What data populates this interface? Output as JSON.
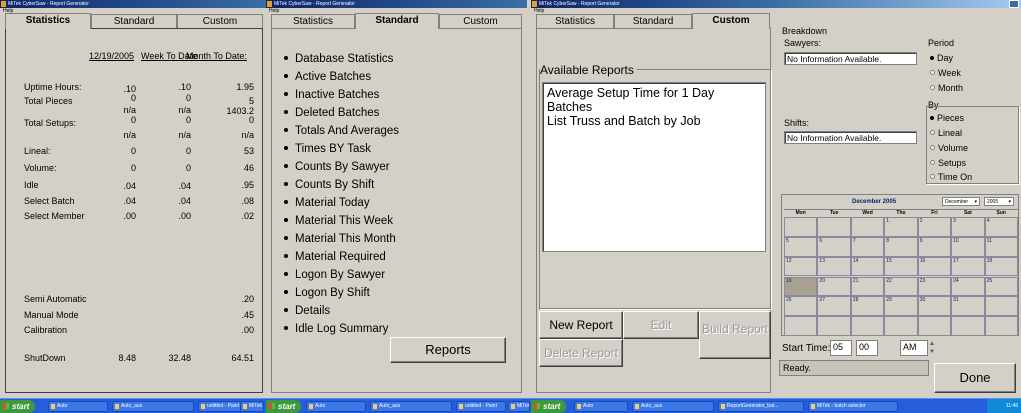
{
  "window1": {
    "title": "MiTek CyberSaw - Report Generator",
    "menu": "Help",
    "tabs": [
      "Statistics",
      "Standard",
      "Custom"
    ],
    "date": "12/19/2005",
    "col_week": "Week To Date",
    "col_month": "Month To Date:",
    "rows": [
      {
        "label": "Uptime Hours:",
        "a": ".10",
        "b": ".10",
        "c": "1.95"
      },
      {
        "label": "Total Pieces",
        "a": "0",
        "b": "0",
        "c": "5"
      },
      {
        "label": "",
        "a": "n/a",
        "b": "n/a",
        "c": "1403.2"
      },
      {
        "label": "Total Setups:",
        "a": "0",
        "b": "0",
        "c": "0"
      },
      {
        "label": "",
        "a": "n/a",
        "b": "n/a",
        "c": "n/a"
      },
      {
        "label": "Lineal:",
        "a": "0",
        "b": "0",
        "c": "53"
      },
      {
        "label": "Volume:",
        "a": "0",
        "b": "0",
        "c": "46"
      },
      {
        "label": "Idle",
        "a": ".04",
        "b": ".04",
        "c": ".95"
      },
      {
        "label": "Select Batch",
        "a": ".04",
        "b": ".04",
        "c": ".08"
      },
      {
        "label": "Select Member",
        "a": ".00",
        "b": ".00",
        "c": ".02"
      }
    ],
    "lower_rows": [
      {
        "label": "Semi Automatic",
        "c": ".20"
      },
      {
        "label": "Manual Mode",
        "c": ".45"
      },
      {
        "label": "Calibration",
        "c": ".00"
      }
    ],
    "shutdown": {
      "label": "ShutDown",
      "a": "8.48",
      "b": "32.48",
      "c": "64.51"
    }
  },
  "window2": {
    "title": "MiTek CyberSaw - Report Generator",
    "menu": "Help",
    "tabs": [
      "Statistics",
      "Standard",
      "Custom"
    ],
    "options": [
      "Database Statistics",
      "Active Batches",
      "Inactive Batches",
      "Deleted Batches",
      "Totals And Averages",
      "Times BY Task",
      "Counts By Sawyer",
      "Counts By Shift",
      "Material Today",
      "Material This Week",
      "Material This Month",
      "Material Required",
      "Logon By Sawyer",
      "Logon By Shift",
      "Details",
      "Idle Log Summary"
    ],
    "reports_button": "Reports"
  },
  "window3": {
    "title": "MiTek CyberSaw - Report Generator",
    "menu": "Help",
    "tabs": [
      "Statistics",
      "Standard",
      "Custom"
    ],
    "group_label": "Available Reports",
    "reports": [
      "Average Setup Time for 1 Day",
      "Batches",
      "List Truss and Batch by Job"
    ],
    "new_report": "New Report",
    "edit": "Edit",
    "build_report": "Build Report",
    "delete_report": "Delete Report"
  },
  "panel": {
    "breakdown": "Breakdown",
    "sawyers_label": "Sawyers:",
    "sawyers_value": "No Information Available.",
    "shifts_label": "Shifts:",
    "shifts_value": "No Information Available.",
    "period_label": "Period",
    "period_options": [
      {
        "label": "Day",
        "selected": true
      },
      {
        "label": "Week",
        "selected": false
      },
      {
        "label": "Month",
        "selected": false
      }
    ],
    "by_label": "By",
    "by_options": [
      {
        "label": "Pieces",
        "selected": true
      },
      {
        "label": "Lineal",
        "selected": false
      },
      {
        "label": "Volume",
        "selected": false
      },
      {
        "label": "Setups",
        "selected": false
      },
      {
        "label": "Time On",
        "selected": false
      }
    ],
    "calendar": {
      "title": "December 2005",
      "month_select": "December",
      "year_select": "2005",
      "days": [
        "Mon",
        "Tue",
        "Wed",
        "Thu",
        "Fri",
        "Sat",
        "Sun"
      ],
      "selected_day": "19",
      "weeks": [
        [
          "",
          "",
          "",
          "1",
          "2",
          "3",
          "4"
        ],
        [
          "5",
          "6",
          "7",
          "8",
          "9",
          "10",
          "11"
        ],
        [
          "12",
          "13",
          "14",
          "15",
          "16",
          "17",
          "18"
        ],
        [
          "19",
          "20",
          "21",
          "22",
          "23",
          "24",
          "25"
        ],
        [
          "26",
          "27",
          "28",
          "29",
          "30",
          "31",
          ""
        ],
        [
          "",
          "",
          "",
          "",
          "",
          "",
          ""
        ]
      ]
    },
    "start_time_label": "Start Time:",
    "hour": "05",
    "minute": "00",
    "ampm": "AM",
    "status": "Ready.",
    "done": "Done"
  },
  "taskbar": {
    "start": "start",
    "tasks": [
      "Auto",
      "Auto_aux",
      "untitled - Paint",
      "MiTek"
    ],
    "tasks3": [
      "Auto",
      "Auto_aux",
      "ReportGenerator_bat...",
      "MiTek - batch selector"
    ],
    "clock": "11:48"
  }
}
